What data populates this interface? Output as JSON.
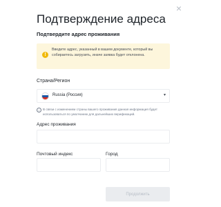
{
  "dialog": {
    "title": "Подтверждение адреса",
    "subtitle": "Подтвердите адрес проживания",
    "close_icon": "×"
  },
  "warning": {
    "icon": "!",
    "text": "Введите адрес, указанный в вашем документе, который вы собираетесь загрузить, иначе заявка будет отклонена."
  },
  "region": {
    "label": "Страна/Регион",
    "selected": "Russia (Россия)",
    "flag_colors": [
      "#ffffff",
      "#1c57a5",
      "#d52b1e"
    ],
    "caret": "▾"
  },
  "info": {
    "icon": "i",
    "text": "В связи с изменением страны вашего проживания данная информация будет использоваться по умолчанию для дальнейших верификаций."
  },
  "form": {
    "address_label": "Адрес проживания",
    "address_value": "",
    "postal_label": "Почтовый индекс",
    "postal_value": "",
    "city_label": "Город",
    "city_value": ""
  },
  "actions": {
    "continue_label": "Продолжить"
  },
  "colors": {
    "accent": "#f0b90b",
    "warning_bg": "#fdf6dc",
    "disabled_bg": "#eaecef",
    "disabled_text": "#b7bdc6"
  }
}
